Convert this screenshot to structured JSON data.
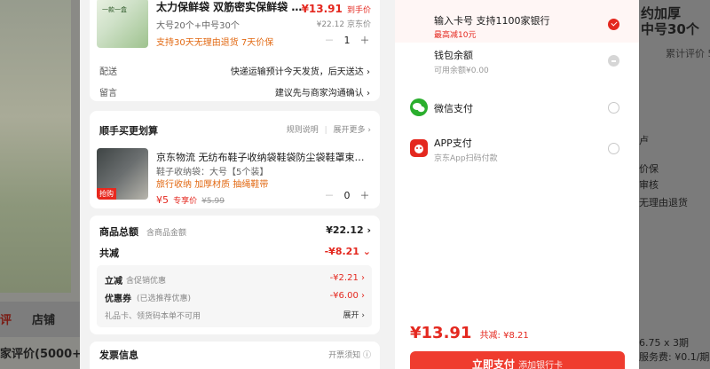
{
  "background": {
    "left_tab_reviews": "评",
    "left_tab_shop": "店铺",
    "left_comments": "家评价(5000+",
    "right_title": "约加厚\n中号30个",
    "right_review_count": "累计评价 5",
    "right_side_1": "卢",
    "right_side_2": "价保",
    "right_side_3": "审核",
    "right_side_4": "无理由退货",
    "right_installment": "6.75 x 3期",
    "right_fee": "服务费: ¥0.1/期"
  },
  "order": {
    "product": {
      "thumb_tag": "一款一盒",
      "title": "太力保鲜袋 双筋密实保鲜袋 密…",
      "price": "¥13.91",
      "price_note": "到手价",
      "spec": "大号20个+中号30个",
      "orig_price": "¥22.12",
      "orig_price_note": "京东价",
      "services": "支持30天无理由退货 7天价保",
      "qty_minus": "－",
      "qty": "1",
      "qty_plus": "＋"
    },
    "delivery": {
      "label": "配送",
      "value": "快递运输预计今天发货，后天送达 ›"
    },
    "message": {
      "label": "留言",
      "value": "建议先与商家沟通确认 ›"
    }
  },
  "addon": {
    "header": "顺手买更划算",
    "rules": "规则说明",
    "more": "展开更多",
    "product": {
      "title": "京东物流 无纺布鞋子收纳袋鞋袋防尘袋鞋罩束口抽…",
      "thumb_tag": "抢购",
      "spec": "鞋子收纳袋：大号【5个装】",
      "tags": "旅行收纳 加厚材质 抽绳鞋带",
      "price": "¥5",
      "price_note": "专享价",
      "orig_price": "¥5.99",
      "qty_minus": "－",
      "qty": "0",
      "qty_plus": "＋"
    }
  },
  "summary": {
    "total_label": "商品总额",
    "total_sub": "含商品金额",
    "total_value": "¥22.12 ›",
    "discount_label": "共减",
    "discount_value": "-¥8.21 ⌄",
    "instant_label": "立减",
    "instant_sub": "含促销优惠",
    "instant_value": "-¥2.21 ›",
    "coupon_label": "优惠券",
    "coupon_sub": "(已选推荐优惠)",
    "coupon_value": "-¥6.00 ›",
    "gift_card": "礼品卡、领货码本单不可用",
    "gift_expand": "展开 ›"
  },
  "invoice": {
    "label": "发票信息",
    "value": "开票须知 ⓘ"
  },
  "payment": {
    "card_title": "输入卡号 支持1100家银行",
    "card_sub": "最高减10元",
    "wallet_title": "钱包余额",
    "wallet_sub": "可用余额¥0.00",
    "wechat_title": "微信支付",
    "app_title": "APP支付",
    "app_sub": "京东App扫码付款",
    "total": "¥13.91",
    "total_saved": "共减: ¥8.21",
    "pay_button": "立即支付",
    "pay_button_hint": "添加银行卡"
  },
  "colors": {
    "accent": "#e4281f",
    "wechat": "#2aae2d"
  }
}
